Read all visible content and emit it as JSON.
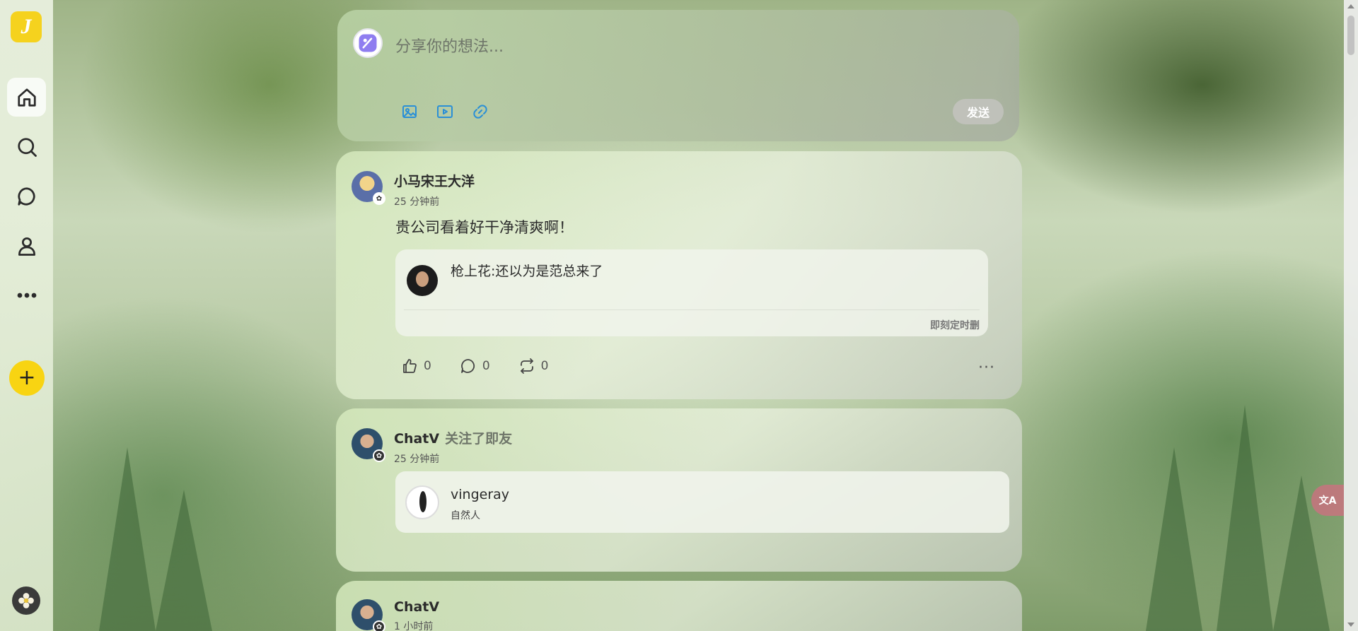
{
  "app": {
    "logo_letter": "J",
    "accent_color": "#f8d412",
    "link_color": "#2a8fd6"
  },
  "sidebar": {
    "items": [
      {
        "name": "home",
        "icon": "home-icon",
        "active": true
      },
      {
        "name": "search",
        "icon": "search-icon",
        "active": false
      },
      {
        "name": "messages",
        "icon": "chat-bubble-icon",
        "active": false
      },
      {
        "name": "profile",
        "icon": "user-icon",
        "active": false
      },
      {
        "name": "more",
        "icon": "more-dots-icon",
        "active": false
      }
    ],
    "add_label": "+"
  },
  "composer": {
    "placeholder": "分享你的想法...",
    "tools": [
      "image-icon",
      "video-icon",
      "link-icon"
    ],
    "send_label": "发送"
  },
  "posts": [
    {
      "author": "小马宋王大洋",
      "time": "25 分钟前",
      "content": "贵公司看着好干净清爽啊！",
      "quote": {
        "text": "枪上花:还以为是范总来了",
        "signature": "即刻定时删"
      },
      "likes": "0",
      "comments": "0",
      "reposts": "0",
      "more": "···"
    },
    {
      "author": "ChatV",
      "action": "关注了即友",
      "time": "25 分钟前",
      "followed": {
        "name": "vingeray",
        "bio": "自然人"
      }
    },
    {
      "author": "ChatV",
      "time": "1 小时前"
    }
  ],
  "translate": {
    "label": "文A"
  }
}
